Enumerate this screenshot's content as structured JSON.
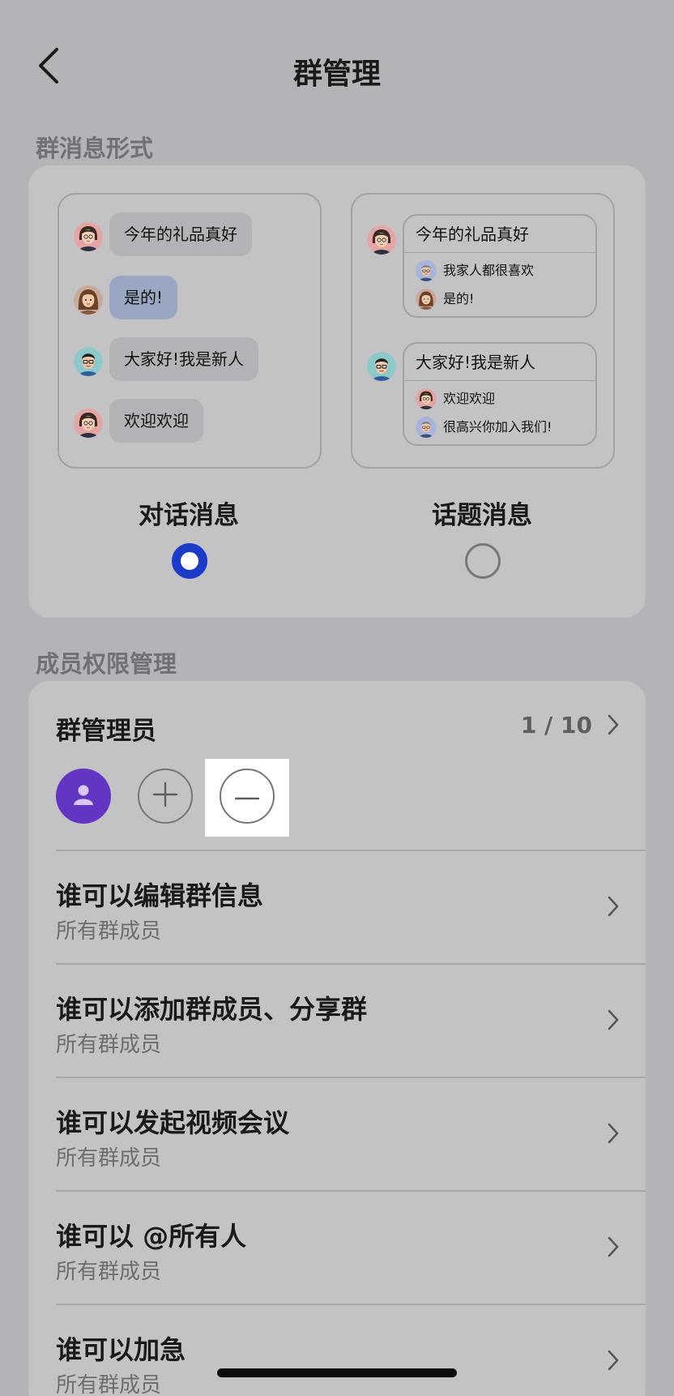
{
  "header": {
    "title": "群管理"
  },
  "format_section": {
    "label": "群消息形式",
    "chat_preview": {
      "messages": [
        "今年的礼品真好",
        "是的!",
        "大家好!我是新人",
        "欢迎欢迎"
      ]
    },
    "topic_preview": {
      "topics": [
        {
          "head": "今年的礼品真好",
          "replies": [
            "我家人都很喜欢",
            "是的!"
          ]
        },
        {
          "head": "大家好!我是新人",
          "replies": [
            "欢迎欢迎",
            "很高兴你加入我们!"
          ]
        }
      ]
    },
    "options": [
      {
        "label": "对话消息",
        "selected": true
      },
      {
        "label": "话题消息",
        "selected": false
      }
    ]
  },
  "perm_section": {
    "label": "成员权限管理",
    "admins": {
      "title": "群管理员",
      "count": "1 / 10"
    },
    "rows": [
      {
        "title": "谁可以编辑群信息",
        "value": "所有群成员"
      },
      {
        "title": "谁可以添加群成员、分享群",
        "value": "所有群成员"
      },
      {
        "title": "谁可以发起视频会议",
        "value": "所有群成员"
      },
      {
        "title": "谁可以 @所有人",
        "value": "所有群成员"
      },
      {
        "title": "谁可以加急",
        "value": "所有群成员"
      }
    ]
  },
  "colors": {
    "accent": "#1d3bc9",
    "admin_avatar": "#6236c2",
    "background": "#b3b4b8"
  }
}
